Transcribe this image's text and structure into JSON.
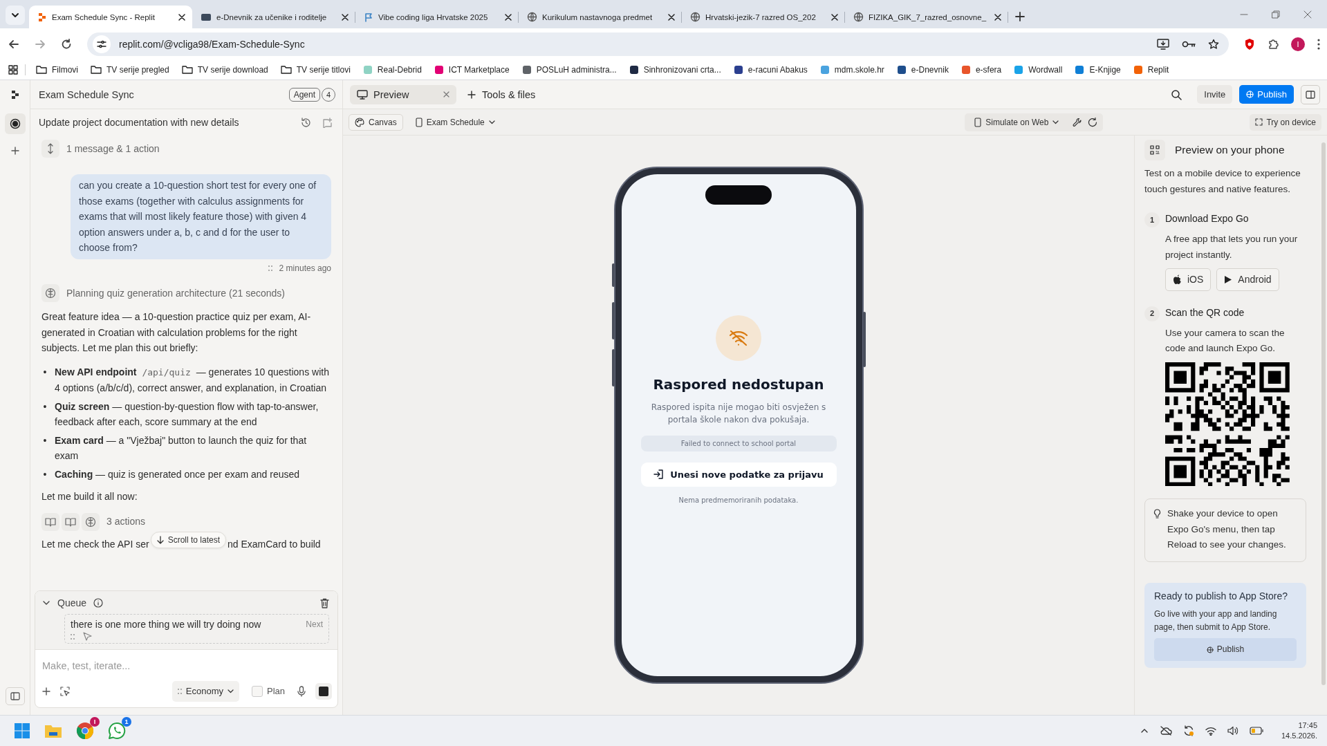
{
  "browser": {
    "tabs": [
      {
        "title": "Exam Schedule Sync - Replit",
        "selected": true
      },
      {
        "title": "e-Dnevnik za učenike i roditelje",
        "selected": false
      },
      {
        "title": "Vibe coding liga Hrvatske 2025",
        "selected": false
      },
      {
        "title": "Kurikulum nastavnoga predmet",
        "selected": false
      },
      {
        "title": "Hrvatski-jezik-7 razred OS_202",
        "selected": false
      },
      {
        "title": "FIZIKA_GIK_7_razred_osnovne_",
        "selected": false
      }
    ],
    "address": "replit.com/@vcliga98/Exam-Schedule-Sync",
    "profile": "I",
    "bookmarks": [
      {
        "label": "Filmovi",
        "kind": "folder"
      },
      {
        "label": "TV serije pregled",
        "kind": "folder"
      },
      {
        "label": "TV serije download",
        "kind": "folder"
      },
      {
        "label": "TV serije titlovi",
        "kind": "folder"
      },
      {
        "label": "Real-Debrid",
        "kind": "site",
        "color": "#8fd3c4"
      },
      {
        "label": "ICT Marketplace",
        "kind": "site",
        "color": "#e20074"
      },
      {
        "label": "POSLuH administra...",
        "kind": "site",
        "color": "#5f6368"
      },
      {
        "label": "Sinhronizovani crta...",
        "kind": "site",
        "color": "#1f2a44"
      },
      {
        "label": "e-racuni Abakus",
        "kind": "site",
        "color": "#2b3f8f"
      },
      {
        "label": "mdm.skole.hr",
        "kind": "site",
        "color": "#4aa3df"
      },
      {
        "label": "e-Dnevnik",
        "kind": "site",
        "color": "#1e4e8c"
      },
      {
        "label": "e-sfera",
        "kind": "site",
        "color": "#e8552b"
      },
      {
        "label": "Wordwall",
        "kind": "site",
        "color": "#1aa3e8"
      },
      {
        "label": "E-Knjige",
        "kind": "site",
        "color": "#0f7fd6"
      },
      {
        "label": "Replit",
        "kind": "site",
        "color": "#f26207"
      }
    ]
  },
  "app": {
    "project_title": "Exam Schedule Sync",
    "agent_label": "Agent",
    "agent_count": "4",
    "tabs": [
      {
        "label": "Preview",
        "selected": true
      }
    ],
    "tools_label": "Tools & files",
    "invite": "Invite",
    "publish": "Publish"
  },
  "chat": {
    "thread_title": "Update project documentation with new details",
    "collapsed": "1 message & 1 action",
    "user_message": "can you create a 10-question short test for every one of those exams (together with calculus assignments for exams that will most likely feature those) with given 4 option answers under a, b, c and d for the user to choose from?",
    "time": "2 minutes ago",
    "thinking": "Planning quiz generation architecture (21 seconds)",
    "intro": "Great feature idea — a 10-question practice quiz per exam, AI-generated in Croatian with calculation problems for the right subjects. Let me plan this out briefly:",
    "bullets": [
      {
        "marker": "•",
        "lead": "New API endpoint",
        "code": "/api/quiz",
        "text": "— generates 10 questions with 4 options (a/b/c/d), correct answer, and explanation, in Croatian"
      },
      {
        "marker": "•",
        "lead": "Quiz screen",
        "text": "— question-by-question flow with tap-to-answer, feedback after each, score summary at the end"
      },
      {
        "marker": "•",
        "lead": "Exam card",
        "text": "— a \"Vježbaj\" button to launch the quiz for that exam"
      },
      {
        "marker": "•",
        "lead": "Caching",
        "text": "— quiz is generated once per exam and reused"
      }
    ],
    "outro": "Let me build it all now:",
    "actions": "3 actions",
    "partial_before": "Let me check the API ser",
    "partial_after": "nd ExamCard to build",
    "scroll_button": "Scroll to latest",
    "queue": {
      "title": "Queue",
      "item": "there is one more thing we will try doing now",
      "next": "Next"
    },
    "input": {
      "placeholder": "Make, test, iterate..."
    },
    "mode": "Economy",
    "plan": {
      "label": "Plan",
      "checked": false
    }
  },
  "preview": {
    "canvas": "Canvas",
    "screen": "Exam Schedule",
    "simulate": "Simulate on Web",
    "try": "Try on device",
    "phone": {
      "title": "Raspored nedostupan",
      "message": "Raspored ispita nije mogao biti osvježen s portala škole nakon dva pokušaja.",
      "error": "Failed to connect to school portal",
      "button": "Unesi nove podatke za prijavu",
      "note": "Nema predmemoriranih podataka."
    }
  },
  "device_panel": {
    "title": "Preview on your phone",
    "intro": "Test on a mobile device to experience touch gestures and native features.",
    "steps": [
      {
        "number": "1",
        "title": "Download Expo Go",
        "text": "A free app that lets you run your project instantly.",
        "buttons": [
          "iOS",
          "Android"
        ]
      },
      {
        "number": "2",
        "title": "Scan the QR code",
        "text": "Use your camera to scan the code and launch Expo Go."
      }
    ],
    "tip": "Shake your device to open Expo Go's menu, then tap Reload to see your changes.",
    "publish_card": {
      "title": "Ready to publish to App Store?",
      "text": "Go live with your app and landing page, then submit to App Store.",
      "button": "Publish"
    }
  },
  "taskbar": {
    "chrome_badge": "I",
    "whatsapp_badge": "1",
    "time": "17:45",
    "date": "14.5.2026."
  }
}
